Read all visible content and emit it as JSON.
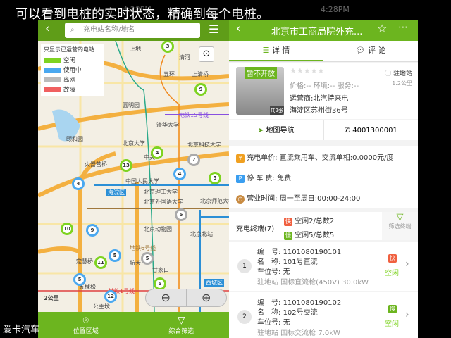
{
  "caption": "可以看到电桩的实时状态，精确到每个电桩。",
  "brand": "爱卡汽车",
  "time": "4:28PM",
  "left": {
    "search_placeholder": "充电站名称/地名",
    "legend": {
      "title": "只显示已运营的电站",
      "items": [
        {
          "label": "空闲",
          "color": "#7ed321"
        },
        {
          "label": "使用中",
          "color": "#4aa8f0"
        },
        {
          "label": "离网",
          "color": "#bbbbbb"
        },
        {
          "label": "故障",
          "color": "#f06060"
        }
      ]
    },
    "map_labels": [
      "上地",
      "清河",
      "五环",
      "上清桥",
      "圆明园",
      "清华大学",
      "颐和园",
      "北京大学",
      "北京科技大学",
      "中关",
      "火器营桥",
      "中国人民大学",
      "海淀区",
      "北京理工大学",
      "北京外国语大学",
      "北京动物园",
      "北京北站",
      "北京师范大学",
      "地铁6号线",
      "定慧桥",
      "航天",
      "甘家口",
      "五棵松",
      "西城区",
      "地铁1号线",
      "地铁15号线",
      "2公里",
      "公主坟"
    ],
    "markers": [
      "3",
      "9",
      "4",
      "13",
      "7",
      "4",
      "5",
      "4",
      "5",
      "10",
      "9",
      "5",
      "11",
      "5",
      "5",
      "5",
      "12"
    ],
    "bottom": [
      {
        "label": "位置区域",
        "icon": "location-pin-icon"
      },
      {
        "label": "综合筛选",
        "icon": "filter-icon"
      }
    ]
  },
  "right": {
    "title": "北京市工商局院外充...",
    "tabs": [
      {
        "label": "详 情"
      },
      {
        "label": "评 论"
      }
    ],
    "station": {
      "badge": "暂不开放",
      "photo_count": "共2张",
      "rating_text": "价格:-- 环境:-- 服务:--",
      "type": "驻地站",
      "distance": "1.2公里",
      "operator": "运营商:北汽特来电",
      "address": "海淀区苏州街36号"
    },
    "nav_label": "地图导航",
    "phone": "4001300001",
    "info": [
      {
        "icon": "¥",
        "label": "充电单价:",
        "value": "直流乘用车、交流单相:0.0000元/度"
      },
      {
        "icon": "P",
        "label": "停 车 费:",
        "value": "免费"
      },
      {
        "icon": "◷",
        "label": "营业时间:",
        "value": "周一至周日:00:00-24:00"
      }
    ],
    "terminals": {
      "title": "充电终端(7)",
      "fast_tag": "快",
      "fast": "空闲2/总数2",
      "slow_tag": "慢",
      "slow": "空闲5/总数5",
      "filter": "筛选终端",
      "items": [
        {
          "num": "1",
          "code_label": "编　号:",
          "code": "1101080190101",
          "name_label": "名　称:",
          "name": "101号直流",
          "spot_label": "车位号:",
          "spot": "无",
          "desc": "驻地站 国标直流枪(450V) 30.0kW",
          "tag": "快",
          "status": "空闲"
        },
        {
          "num": "2",
          "code_label": "编　号:",
          "code": "1101080190102",
          "name_label": "名　称:",
          "name": "102号交流",
          "spot_label": "车位号:",
          "spot": "无",
          "desc": "驻地站 国标交流枪 7.0kW",
          "tag": "慢",
          "status": "空闲"
        }
      ]
    }
  }
}
